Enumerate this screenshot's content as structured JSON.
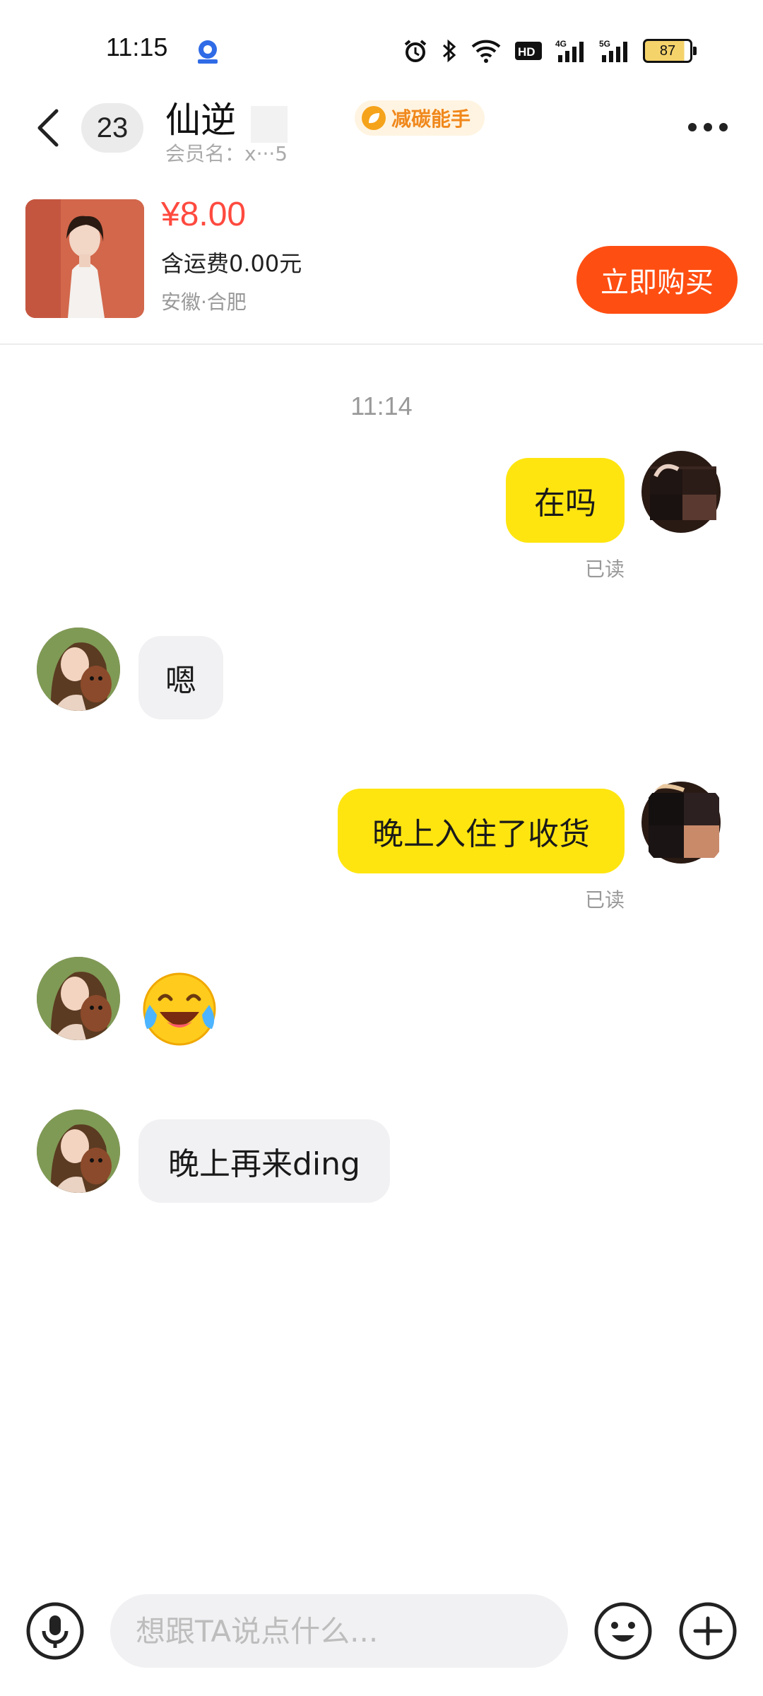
{
  "status_bar": {
    "time": "11:15",
    "battery": "87"
  },
  "header": {
    "unread_count": "23",
    "contact_name": "仙逆",
    "member_label": "会员名：x···5",
    "badge_label": "减碳能手"
  },
  "product": {
    "price": "¥8.00",
    "shipping": "含运费0.00元",
    "location": "安徽·合肥",
    "buy_label": "立即购买"
  },
  "chat": {
    "timestamp": "11:14",
    "messages": [
      {
        "from": "self",
        "text": "在吗",
        "status": "已读"
      },
      {
        "from": "peer",
        "text": "嗯"
      },
      {
        "from": "self",
        "text": "晚上入住了收货",
        "status": "已读"
      },
      {
        "from": "peer",
        "emoji": "tears-of-joy-emoji"
      },
      {
        "from": "peer",
        "text": "晚上再来ding"
      }
    ]
  },
  "input_bar": {
    "placeholder": "想跟TA说点什么..."
  },
  "colors": {
    "accent_orange": "#ff4e12",
    "price_red": "#ff4a3f",
    "bubble_self": "#ffe50f",
    "bubble_peer": "#f1f1f3"
  }
}
